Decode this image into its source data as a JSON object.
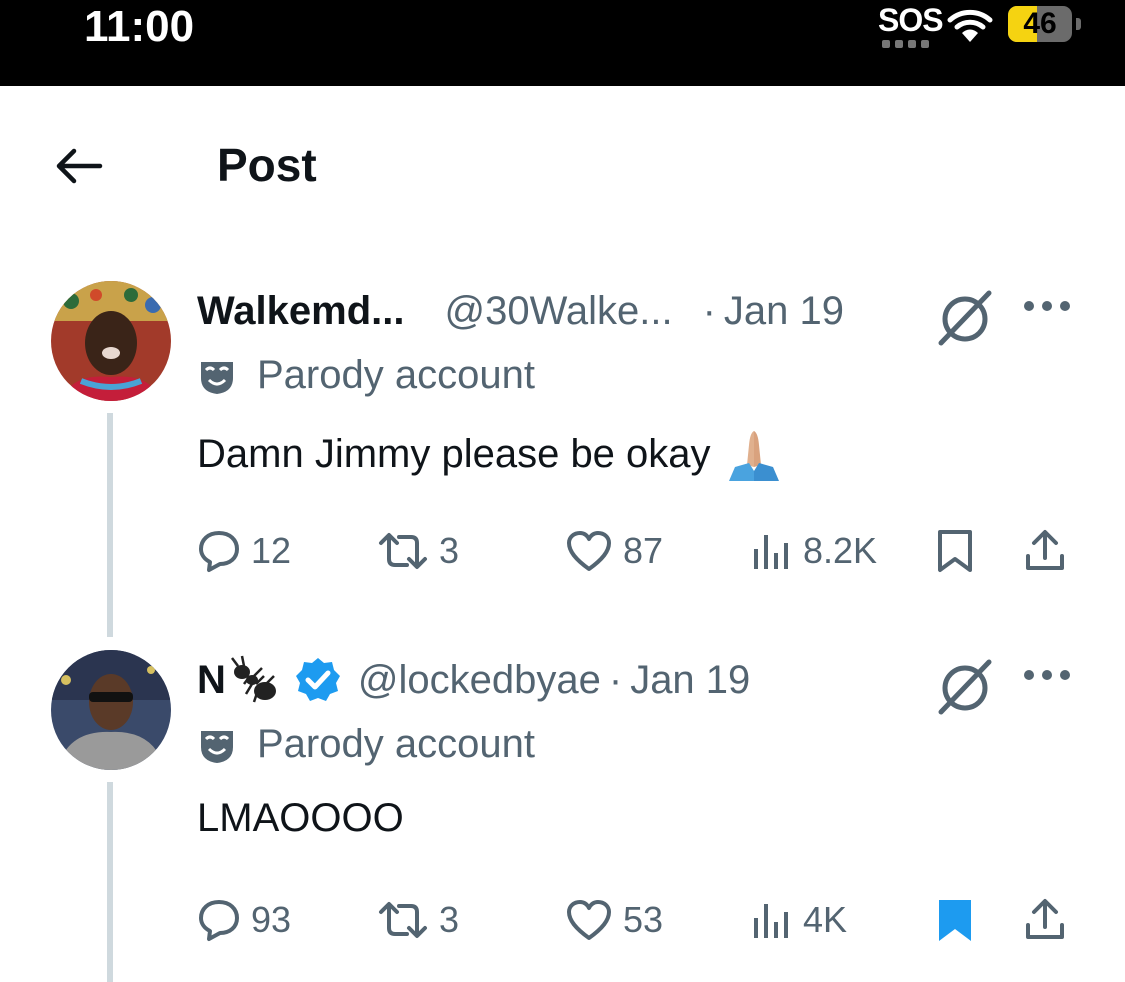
{
  "status_bar": {
    "time": "11:00",
    "sos": "SOS",
    "battery": "46",
    "battery_level": 0.46
  },
  "header": {
    "title": "Post"
  },
  "posts": [
    {
      "display_name": "Walkemd...",
      "handle": "@30Walke...",
      "separator": "·",
      "date": "Jan 19",
      "label": "Parody account",
      "text": "Damn Jimmy please be okay",
      "emoji": "folded-hands-emoji",
      "stats": {
        "replies": "12",
        "reposts": "3",
        "likes": "87",
        "views": "8.2K"
      },
      "bookmarked": false
    },
    {
      "display_name": "N",
      "handle": "@lockedbyae",
      "separator": "·",
      "date": "Jan 19",
      "label": "Parody account",
      "verified": true,
      "name_emoji": "ant-emoji",
      "text": "LMAOOOO",
      "stats": {
        "replies": "93",
        "reposts": "3",
        "likes": "53",
        "views": "4K"
      },
      "bookmarked": true
    }
  ],
  "colors": {
    "secondary_text": "#536471",
    "verified_blue": "#1d9bf0",
    "thread_line": "#cfd9de"
  }
}
